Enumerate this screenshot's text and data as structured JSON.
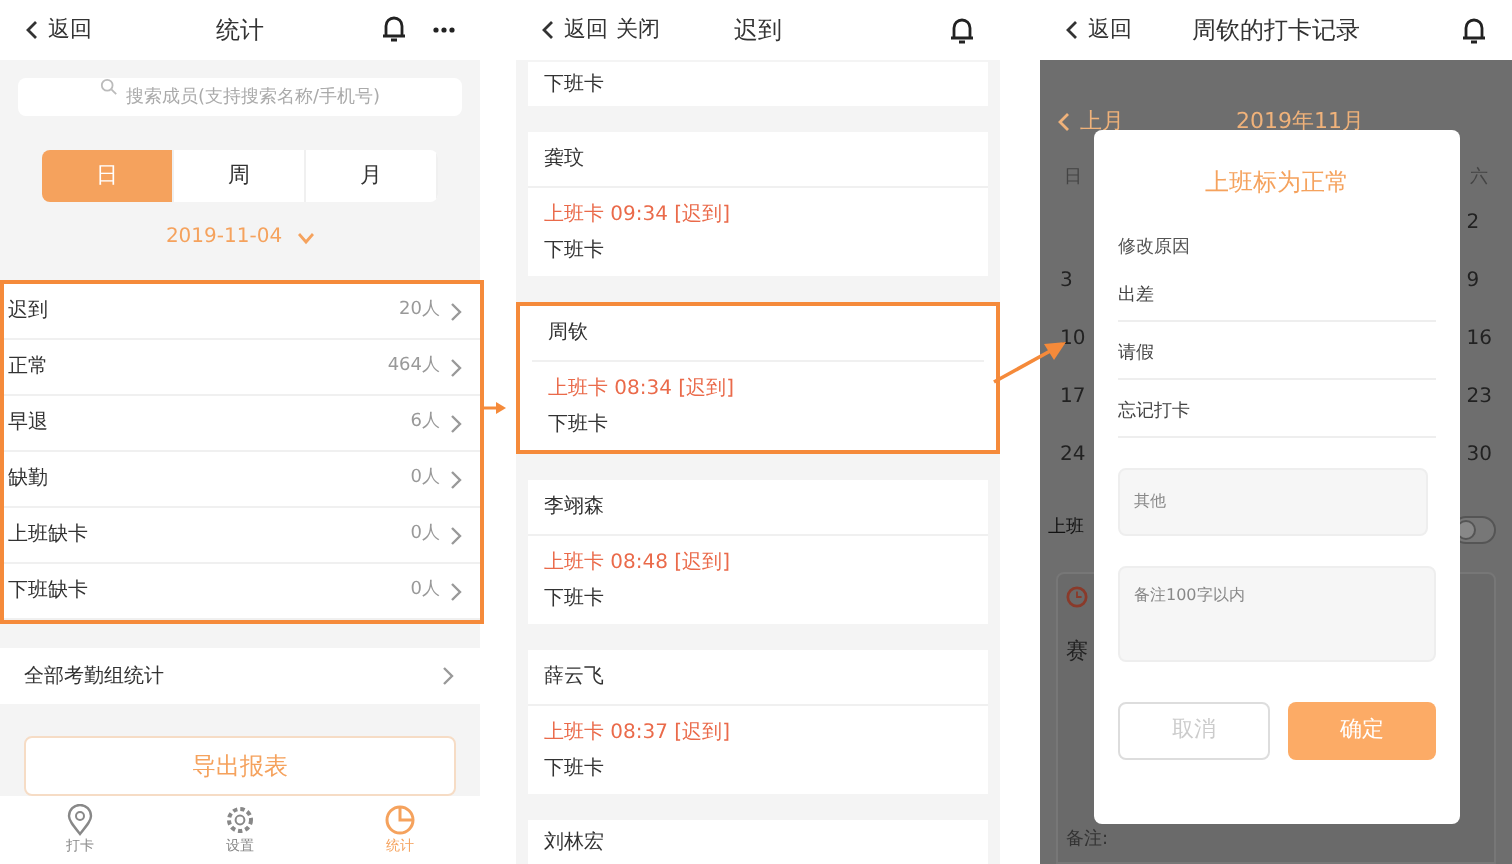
{
  "stats_screen": {
    "back": "返回",
    "title": "统计",
    "search": {
      "placeholder": "搜索成员(支持搜索名称/手机号)"
    },
    "periods": [
      {
        "label": "日",
        "selected": true
      },
      {
        "label": "周",
        "selected": false
      },
      {
        "label": "月",
        "selected": false
      }
    ],
    "date": "2019-11-04",
    "rows_highlighted": true,
    "rows": [
      {
        "label": "迟到",
        "count": "20人"
      },
      {
        "label": "正常",
        "count": "464人"
      },
      {
        "label": "早退",
        "count": "6人"
      },
      {
        "label": "缺勤",
        "count": "0人"
      },
      {
        "label": "上班缺卡",
        "count": "0人"
      },
      {
        "label": "下班缺卡",
        "count": "0人"
      }
    ],
    "group_stats": "全部考勤组统计",
    "export_button": "导出报表",
    "tabs": [
      {
        "kind": "pin",
        "label": "打卡",
        "selected": false
      },
      {
        "kind": "gear",
        "label": "设置",
        "selected": false
      },
      {
        "kind": "pie",
        "label": "统计",
        "selected": true
      }
    ]
  },
  "late_screen": {
    "back": "返回",
    "close": "关闭",
    "title": "迟到",
    "top_partial": "下班卡",
    "groups": [
      {
        "name": "龚玟",
        "check_in": "上班卡 09:34 [迟到]",
        "check_out": "下班卡",
        "highlighted": false
      },
      {
        "name": "周钦",
        "check_in": "上班卡 08:34 [迟到]",
        "check_out": "下班卡",
        "highlighted": true
      },
      {
        "name": "李翊森",
        "check_in": "上班卡 08:48 [迟到]",
        "check_out": "下班卡",
        "highlighted": false
      },
      {
        "name": "薛云飞",
        "check_in": "上班卡 08:37 [迟到]",
        "check_out": "下班卡",
        "highlighted": false
      }
    ],
    "last_name": "刘林宏"
  },
  "record_screen": {
    "back": "返回",
    "title": "周钦的打卡记录",
    "background": {
      "prev_month": "上月",
      "month": "2019年11月",
      "weekday_left": "日",
      "weekday_right": "六",
      "left_dates": [
        "3",
        "10",
        "17",
        "24"
      ],
      "right_dates": [
        "2",
        "9",
        "16",
        "23",
        "30"
      ],
      "shift_label": "上班",
      "shift_toggle_on": false,
      "card_title": "赛",
      "note_label": "备注:"
    },
    "dialog": {
      "title": "上班标为正常",
      "reason_label": "修改原因",
      "options": [
        "出差",
        "请假",
        "忘记打卡"
      ],
      "other": {
        "placeholder": "其他"
      },
      "note": {
        "placeholder": "备注100字以内"
      },
      "cancel": "取消",
      "confirm": "确定"
    }
  }
}
